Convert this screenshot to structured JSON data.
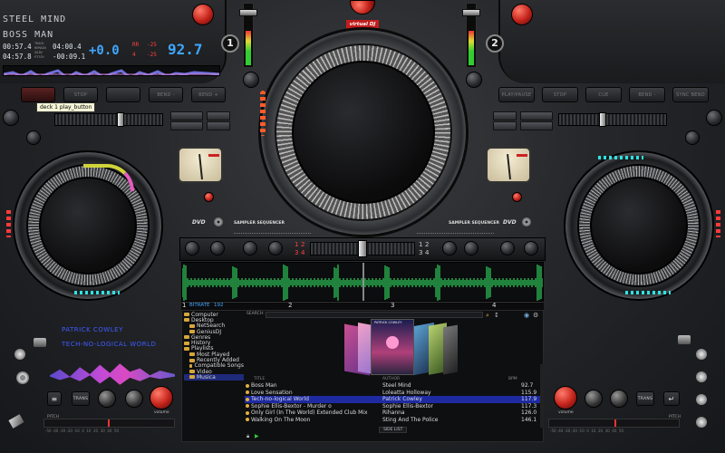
{
  "deck1": {
    "artist_name": "STEEL MIND",
    "track_title": "BOSS MAN",
    "elapsed": "00:57.4",
    "remain": "04:00.4",
    "total": "04:57.8",
    "remain2": "-00:09.1",
    "label_track": "TRACK",
    "label_remain": "REMAIN",
    "label_gain": "GAIN",
    "label_pitch": "PITCH",
    "pitch": "+0.0",
    "rr1": "RR",
    "rr1_val": "-25",
    "rr2": "4",
    "rr2_val": "-25",
    "bpm": "92.7",
    "number": "1",
    "buttons": [
      "",
      "STOP",
      "",
      "BEND -",
      "BEND +"
    ],
    "tooltip": "deck 1 play_button"
  },
  "deck2": {
    "number": "2",
    "buttons": [
      "PLAY/PAUSE",
      "STOP",
      "CUE",
      "BEND -",
      "SYNC BEND"
    ]
  },
  "logo": "virtual DJ",
  "sampler": {
    "left": "SAMPLER SEQUENCER",
    "right": "SAMPLER SEQUENCER",
    "dvd_left": "DVD",
    "dvd_right": "DVD",
    "nums_left": [
      "1",
      "2",
      "3",
      "4"
    ],
    "nums_right": [
      "1",
      "2",
      "3",
      "4"
    ]
  },
  "bitrate": {
    "label": "BITRATE",
    "value": "192"
  },
  "beat_markers": [
    "1",
    "2",
    "3",
    "4"
  ],
  "now_playing": {
    "artist": "PATRICK COWLEY",
    "title": "TECH-NO-LOGICAL WORLD"
  },
  "left_panel": {
    "pitch_label": "PITCH",
    "volume_label": "volume",
    "trans_label": "TRANS",
    "scale": "-50 -40 -30 -20 -10  0  10  20  30  40  50"
  },
  "right_panel": {
    "pitch_label": "PITCH",
    "volume_label": "volume",
    "trans_label": "TRANS",
    "scale": "-50 -40 -30 -20 -10  0  10  20  30  40  50"
  },
  "search": {
    "label": "SEARCH:",
    "value": ""
  },
  "cover": {
    "artist": "PATRICK COWLEY"
  },
  "folders": [
    {
      "label": "Computer"
    },
    {
      "label": "Desktop"
    },
    {
      "label": "NetSearch"
    },
    {
      "label": "GeniusDJ"
    },
    {
      "label": "Genres"
    },
    {
      "label": "History"
    },
    {
      "label": "Playlists"
    },
    {
      "label": "Most Played"
    },
    {
      "label": "Recently Added"
    },
    {
      "label": "Compatible Songs"
    },
    {
      "label": "Video"
    },
    {
      "label": "Musica"
    }
  ],
  "table": {
    "headers": [
      "TITLE",
      "AUTHOR",
      "BPM"
    ],
    "rows": [
      {
        "title": "Boss Man",
        "author": "Steel Mind",
        "bpm": "92.7"
      },
      {
        "title": "Love Sensation",
        "author": "Loleatta Holloway",
        "bpm": "115.9"
      },
      {
        "title": "Tech-no-logical World",
        "author": "Patrick Cowley",
        "bpm": "117.9"
      },
      {
        "title": "Sophie Ellis-Bextor - Murder o",
        "author": "Sophie Ellis-Bextor",
        "bpm": "117.3"
      },
      {
        "title": "Only Girl (In The World) Extended Club Mix",
        "author": "Rihanna",
        "bpm": "126.0"
      },
      {
        "title": "Walking On The Moon",
        "author": "Sting And The Police",
        "bpm": "146.1"
      }
    ],
    "side_list": "SIDE LIST"
  },
  "colors": {
    "accent_blue": "#3fa7ff",
    "selected_row": "#1e2aa0",
    "led_red": "#ff2a2a",
    "led_cyan": "#2fe3e3",
    "waveform": "#2fd05a"
  }
}
